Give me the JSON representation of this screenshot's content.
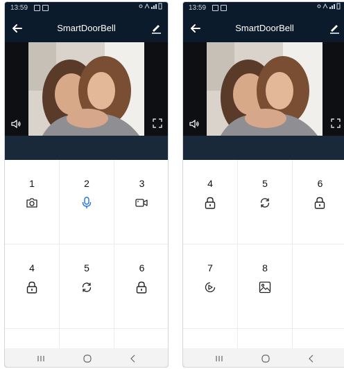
{
  "status": {
    "time": "13:59"
  },
  "app": {
    "title": "SmartDoorBell"
  },
  "colors": {
    "accent": "#1d6fe6",
    "dark": "#0b1b2b"
  },
  "screens": [
    {
      "id": "left",
      "cells": [
        {
          "label": "1",
          "icon": "camera-icon"
        },
        {
          "label": "2",
          "icon": "microphone-icon"
        },
        {
          "label": "3",
          "icon": "video-camera-icon"
        },
        {
          "label": "4",
          "icon": "lock-icon"
        },
        {
          "label": "5",
          "icon": "refresh-icon"
        },
        {
          "label": "6",
          "icon": "lock-icon"
        }
      ]
    },
    {
      "id": "right",
      "cells": [
        {
          "label": "4",
          "icon": "lock-icon"
        },
        {
          "label": "5",
          "icon": "refresh-icon"
        },
        {
          "label": "6",
          "icon": "lock-icon"
        },
        {
          "label": "7",
          "icon": "play-clock-icon"
        },
        {
          "label": "8",
          "icon": "image-icon"
        }
      ]
    }
  ]
}
